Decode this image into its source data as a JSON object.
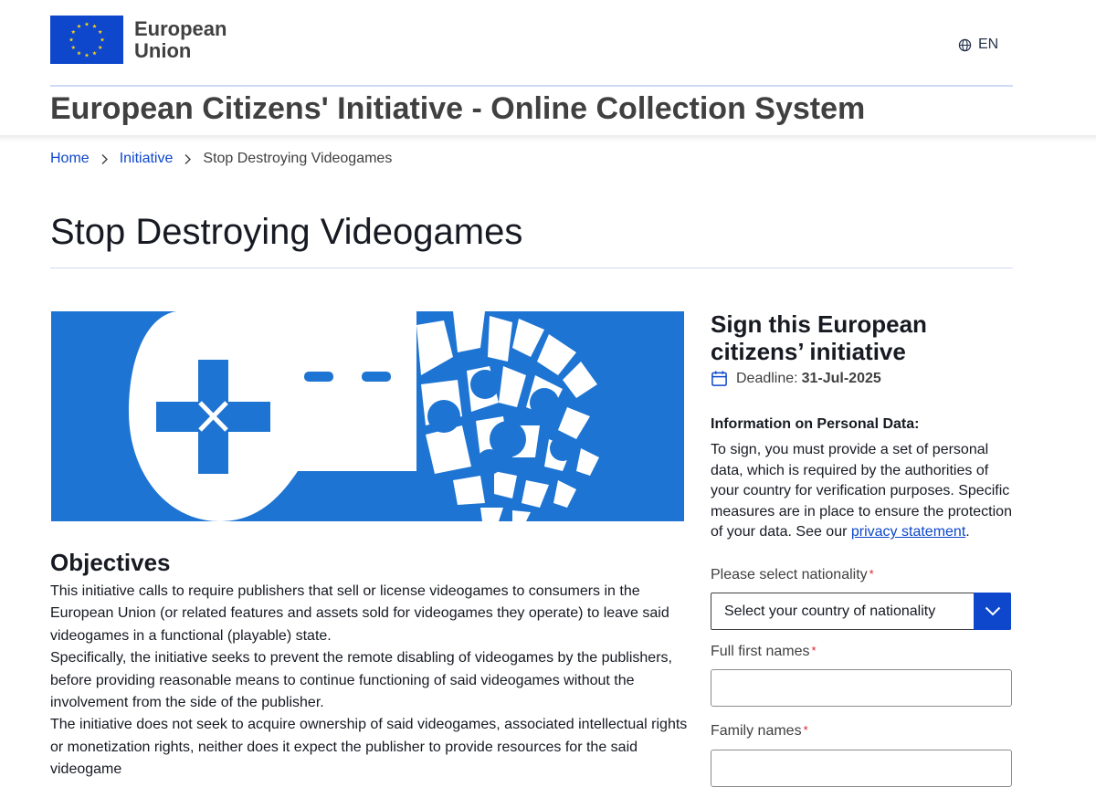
{
  "header": {
    "logo_line1": "European",
    "logo_line2": "Union",
    "language": "EN",
    "site_title": "European Citizens' Initiative - Online Collection System"
  },
  "breadcrumb": {
    "home": "Home",
    "initiative": "Initiative",
    "current": "Stop Destroying Videogames"
  },
  "page_title": "Stop Destroying Videogames",
  "objectives": {
    "title": "Objectives",
    "paragraphs": [
      "This initiative calls to require publishers that sell or license videogames to consumers in the European Union (or related features and assets sold for videogames they operate) to leave said videogames in a functional (playable) state.",
      "Specifically, the initiative seeks to prevent the remote disabling of videogames by the publishers, before providing reasonable means to continue functioning of said videogames without the involvement from the side of the publisher.",
      "The initiative does not seek to acquire ownership of said videogames, associated intellectual rights or monetization rights, neither does it expect the publisher to provide resources for the said videogame"
    ]
  },
  "sign": {
    "title": "Sign this European citizens’ initiative",
    "deadline_label": "Deadline:",
    "deadline_value": "31-Jul-2025",
    "info_title": "Information on Personal Data:",
    "info_text": "To sign, you must provide a set of personal data, which is required by the authorities of your country for verification purposes. Specific measures are in place to ensure the protection of your data. See our ",
    "privacy_link": "privacy statement",
    "info_text_end": "."
  },
  "form": {
    "nationality_label": "Please select nationality",
    "nationality_placeholder": "Select your country of nationality",
    "first_names_label": "Full first names",
    "family_names_label": "Family names",
    "required_mark": "*"
  },
  "colors": {
    "eu_blue": "#0e47cb",
    "hero_blue": "#1e74d2",
    "star_yellow": "#ffd617",
    "required_red": "#da2131"
  },
  "icons": {
    "language": "globe-icon",
    "breadcrumb_separator": "chevron-right-icon",
    "deadline": "calendar-icon",
    "select": "chevron-down-icon"
  }
}
